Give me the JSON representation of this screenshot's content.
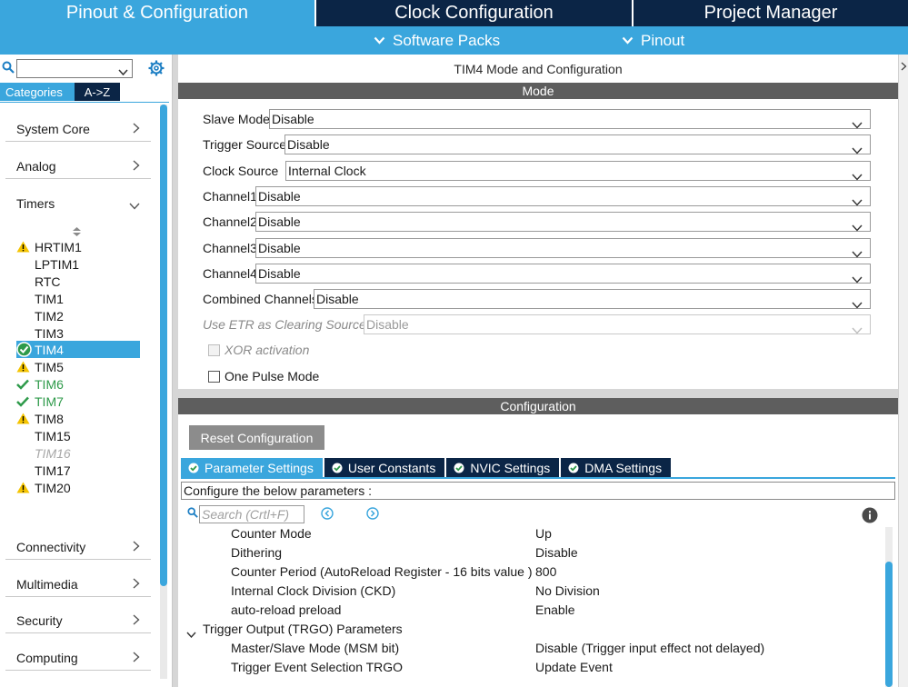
{
  "top_tabs": [
    {
      "label": "Pinout & Configuration",
      "active": true
    },
    {
      "label": "Clock Configuration",
      "active": false
    },
    {
      "label": "Project Manager",
      "active": false
    }
  ],
  "sub_menus": [
    {
      "label": "Software Packs",
      "icon": "chevron-down-icon"
    },
    {
      "label": "Pinout",
      "icon": "chevron-down-icon"
    }
  ],
  "left": {
    "search_value": "",
    "category_tabs": [
      "Categories",
      "A->Z"
    ],
    "categories_top": [
      {
        "label": "System Core",
        "expanded": false
      },
      {
        "label": "Analog",
        "expanded": false
      },
      {
        "label": "Timers",
        "expanded": true
      }
    ],
    "timers": [
      {
        "name": "HRTIM1",
        "status": "warning"
      },
      {
        "name": "LPTIM1",
        "status": "none"
      },
      {
        "name": "RTC",
        "status": "none"
      },
      {
        "name": "TIM1",
        "status": "none"
      },
      {
        "name": "TIM2",
        "status": "none"
      },
      {
        "name": "TIM3",
        "status": "none"
      },
      {
        "name": "TIM4",
        "status": "selected"
      },
      {
        "name": "TIM5",
        "status": "warning"
      },
      {
        "name": "TIM6",
        "status": "ok"
      },
      {
        "name": "TIM7",
        "status": "ok"
      },
      {
        "name": "TIM8",
        "status": "warning"
      },
      {
        "name": "TIM15",
        "status": "none"
      },
      {
        "name": "TIM16",
        "status": "disabled"
      },
      {
        "name": "TIM17",
        "status": "none"
      },
      {
        "name": "TIM20",
        "status": "warning"
      }
    ],
    "categories_bottom": [
      {
        "label": "Connectivity"
      },
      {
        "label": "Multimedia"
      },
      {
        "label": "Security"
      },
      {
        "label": "Computing"
      }
    ]
  },
  "main": {
    "title": "TIM4 Mode and Configuration",
    "mode_header": "Mode",
    "mode_fields": [
      {
        "label": "Slave Mode",
        "value": "Disable",
        "disabled": false
      },
      {
        "label": "Trigger Source",
        "value": "Disable",
        "disabled": false
      },
      {
        "label": "Clock Source",
        "value": "Internal Clock",
        "disabled": false
      },
      {
        "label": "Channel1",
        "value": "Disable",
        "disabled": false
      },
      {
        "label": "Channel2",
        "value": "Disable",
        "disabled": false
      },
      {
        "label": "Channel3",
        "value": "Disable",
        "disabled": false
      },
      {
        "label": "Channel4",
        "value": "Disable",
        "disabled": false
      },
      {
        "label": "Combined Channels",
        "value": "Disable",
        "disabled": false
      },
      {
        "label": "Use ETR as Clearing Source",
        "value": "Disable",
        "disabled": true
      }
    ],
    "checkboxes": [
      {
        "label": "XOR activation",
        "checked": false,
        "disabled": true
      },
      {
        "label": "One Pulse Mode",
        "checked": false,
        "disabled": false
      }
    ],
    "config_header": "Configuration",
    "reset_label": "Reset Configuration",
    "param_tabs": [
      {
        "label": "Parameter Settings",
        "active": true
      },
      {
        "label": "User Constants",
        "active": false
      },
      {
        "label": "NVIC Settings",
        "active": false
      },
      {
        "label": "DMA Settings",
        "active": false
      }
    ],
    "configure_text": "Configure the below parameters :",
    "search_placeholder": "Search (Crtl+F)",
    "params": [
      {
        "name": "Counter Mode",
        "value": "Up",
        "group": false
      },
      {
        "name": "Dithering",
        "value": "Disable",
        "group": false
      },
      {
        "name": "Counter Period (AutoReload Register - 16 bits value )",
        "value": "800",
        "group": false
      },
      {
        "name": "Internal Clock Division (CKD)",
        "value": "No Division",
        "group": false
      },
      {
        "name": "auto-reload preload",
        "value": "Enable",
        "group": false
      },
      {
        "name": "Trigger Output (TRGO) Parameters",
        "value": "",
        "group": true
      },
      {
        "name": "Master/Slave Mode (MSM bit)",
        "value": "Disable (Trigger input effect not delayed)",
        "group": false
      },
      {
        "name": "Trigger Event Selection TRGO",
        "value": "Update Event",
        "group": false
      }
    ]
  },
  "colors": {
    "accent_blue": "#3aa6dd",
    "navy": "#0b2546",
    "section_gray": "#5e5e5e",
    "ok_green": "#2e9a4a",
    "warning_yellow": "#f5c400"
  }
}
